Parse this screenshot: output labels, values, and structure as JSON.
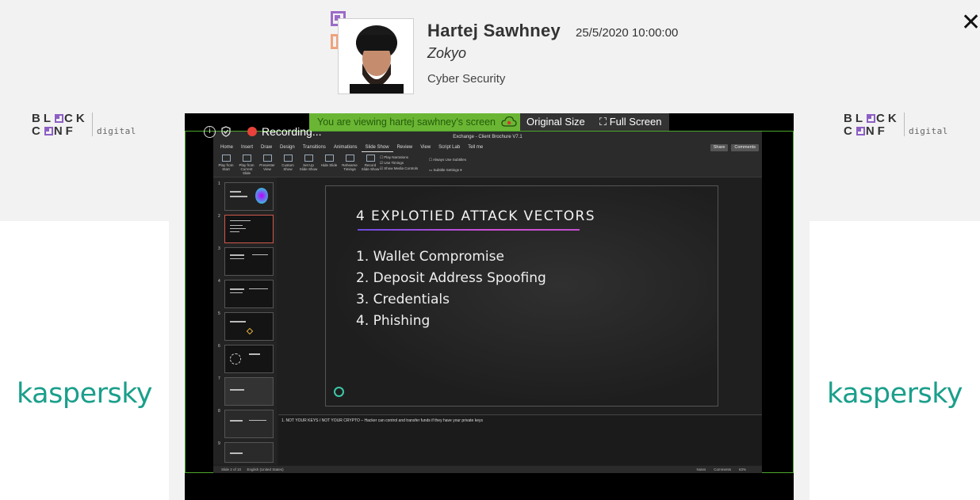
{
  "header": {
    "speaker_name": "Hartej Sawhney",
    "datetime": "25/5/2020 10:00:00",
    "company": "Zokyo",
    "track": "Cyber Security",
    "close_icon": "close-icon"
  },
  "logos": {
    "blockconf_line1": [
      "BL",
      "CK"
    ],
    "blockconf_line2": [
      "C",
      "NF"
    ],
    "blockconf_sub": "digital"
  },
  "sponsors": {
    "left": "kaspersky",
    "right": "kaspersky",
    "brand_color": "#1a9f8b"
  },
  "screen_share": {
    "banner_text": "You are viewing hartej sawhney's screen",
    "original_size_label": "Original Size",
    "full_screen_label": "Full Screen",
    "recording_label": "Recording...",
    "frame_color": "#4ca62c",
    "banner_color": "#6ab634"
  },
  "ppt": {
    "window_title": "Exchange - Client Brochure V7.1",
    "menu_tabs": [
      "Home",
      "Insert",
      "Draw",
      "Design",
      "Transitions",
      "Animations",
      "Slide Show",
      "Review",
      "View",
      "Script Lab",
      "Tell me"
    ],
    "active_tab": "Slide Show",
    "share_label": "Share",
    "comments_label": "Comments",
    "ribbon_buttons": [
      "Play from Start",
      "Play from Current Slide",
      "Presenter View",
      "Custom Show",
      "Set Up Slide Show",
      "Hide Slide",
      "Rehearse Timings",
      "Record Slide Show"
    ],
    "ribbon_checks": [
      "Play Narrations",
      "Use Timings",
      "Show Media Controls"
    ],
    "ribbon_subtitles": [
      "Always Use Subtitles",
      "Subtitle Settings"
    ],
    "slide": {
      "title": "4 EXPLOTIED ATTACK VECTORS",
      "items": [
        "1.  Wallet Compromise",
        "2.  Deposit Address Spoofing",
        "3.  Credentials",
        "4.  Phishing"
      ]
    },
    "thumbnails": [
      "1",
      "2",
      "3",
      "4",
      "5",
      "6",
      "7",
      "8",
      "9"
    ],
    "notes": "1.     NOT YOUR KEYS  / NOT YOUR CRYPTO – Hacker can control and transfer funds if they have your private keys",
    "status_left": "Slide 2 of 10",
    "status_lang": "English (United States)",
    "status_notes": "Notes",
    "status_comments": "Comments",
    "zoom": "63%"
  }
}
